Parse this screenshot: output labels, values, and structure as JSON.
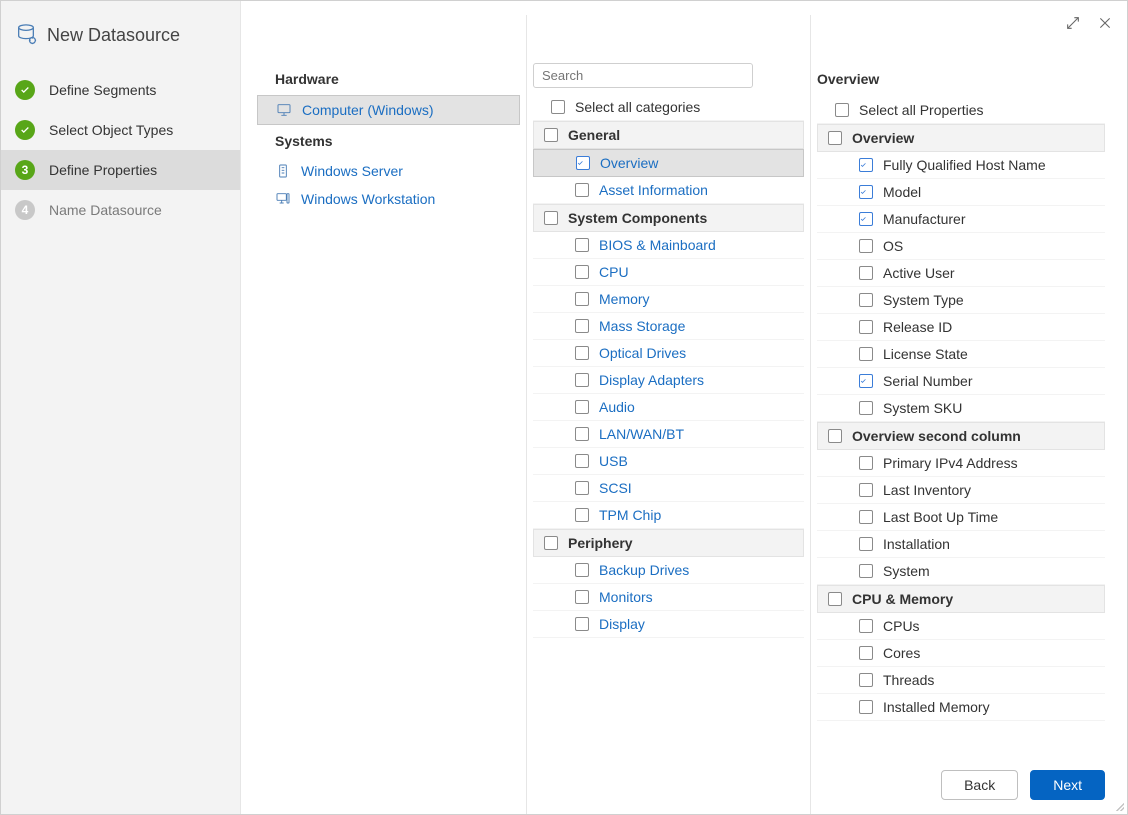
{
  "title": "New Datasource",
  "steps": [
    {
      "num": "1",
      "label": "Define Segments",
      "state": "done"
    },
    {
      "num": "2",
      "label": "Select Object Types",
      "state": "done"
    },
    {
      "num": "3",
      "label": "Define Properties",
      "state": "current"
    },
    {
      "num": "4",
      "label": "Name Datasource",
      "state": "future"
    }
  ],
  "search_placeholder": "Search",
  "buttons": {
    "back": "Back",
    "next": "Next"
  },
  "object_groups": [
    {
      "header": "Hardware",
      "items": [
        {
          "label": "Computer (Windows)",
          "icon": "computer-windows-icon",
          "selected": true
        }
      ]
    },
    {
      "header": "Systems",
      "items": [
        {
          "label": "Windows Server",
          "icon": "server-icon",
          "selected": false
        },
        {
          "label": "Windows Workstation",
          "icon": "workstation-icon",
          "selected": false
        }
      ]
    }
  ],
  "categories": {
    "select_all_label": "Select all categories",
    "groups": [
      {
        "name": "General",
        "checked": false,
        "items": [
          {
            "label": "Overview",
            "checked": true,
            "selected": true
          },
          {
            "label": "Asset Information",
            "checked": false,
            "selected": false
          }
        ]
      },
      {
        "name": "System Components",
        "checked": false,
        "items": [
          {
            "label": "BIOS & Mainboard",
            "checked": false
          },
          {
            "label": "CPU",
            "checked": false
          },
          {
            "label": "Memory",
            "checked": false
          },
          {
            "label": "Mass Storage",
            "checked": false
          },
          {
            "label": "Optical Drives",
            "checked": false
          },
          {
            "label": "Display Adapters",
            "checked": false
          },
          {
            "label": "Audio",
            "checked": false
          },
          {
            "label": "LAN/WAN/BT",
            "checked": false
          },
          {
            "label": "USB",
            "checked": false
          },
          {
            "label": "SCSI",
            "checked": false
          },
          {
            "label": "TPM Chip",
            "checked": false
          }
        ]
      },
      {
        "name": "Periphery",
        "checked": false,
        "items": [
          {
            "label": "Backup Drives",
            "checked": false
          },
          {
            "label": "Monitors",
            "checked": false
          },
          {
            "label": "Display",
            "checked": false
          }
        ]
      }
    ]
  },
  "properties": {
    "title": "Overview",
    "select_all_label": "Select all Properties",
    "groups": [
      {
        "name": "Overview",
        "checked": false,
        "items": [
          {
            "label": "Fully Qualified Host Name",
            "checked": true
          },
          {
            "label": "Model",
            "checked": true
          },
          {
            "label": "Manufacturer",
            "checked": true
          },
          {
            "label": "OS",
            "checked": false
          },
          {
            "label": "Active User",
            "checked": false
          },
          {
            "label": "System Type",
            "checked": false
          },
          {
            "label": "Release ID",
            "checked": false
          },
          {
            "label": "License State",
            "checked": false
          },
          {
            "label": "Serial Number",
            "checked": true
          },
          {
            "label": "System SKU",
            "checked": false
          }
        ]
      },
      {
        "name": "Overview second column",
        "checked": false,
        "items": [
          {
            "label": "Primary IPv4 Address",
            "checked": false
          },
          {
            "label": "Last Inventory",
            "checked": false
          },
          {
            "label": "Last Boot Up Time",
            "checked": false
          },
          {
            "label": "Installation",
            "checked": false
          },
          {
            "label": "System",
            "checked": false
          }
        ]
      },
      {
        "name": "CPU & Memory",
        "checked": false,
        "items": [
          {
            "label": "CPUs",
            "checked": false
          },
          {
            "label": "Cores",
            "checked": false
          },
          {
            "label": "Threads",
            "checked": false
          },
          {
            "label": "Installed Memory",
            "checked": false
          }
        ]
      }
    ]
  }
}
